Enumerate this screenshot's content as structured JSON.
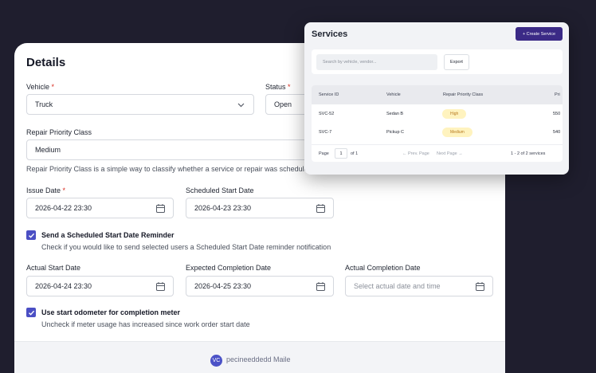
{
  "details": {
    "title": "Details",
    "vehicle": {
      "label": "Vehicle",
      "required_mark": "*",
      "value": "Truck"
    },
    "status": {
      "label": "Status",
      "required_mark": "*",
      "value": "Open"
    },
    "repair_priority": {
      "label": "Repair Priority Class",
      "value": "Medium",
      "helper": "Repair Priority Class is a simple way to classify whether a service or repair was schedule"
    },
    "issue_date": {
      "label": "Issue Date",
      "required_mark": "*",
      "value": "2026-04-22 23:30"
    },
    "scheduled_start": {
      "label": "Scheduled Start Date",
      "value": "2026-04-23 23:30"
    },
    "reminder": {
      "checked": true,
      "title": "Send a Scheduled Start Date Reminder",
      "helper": "Check if you would like to send selected users a Scheduled Start Date reminder notification"
    },
    "actual_start": {
      "label": "Actual Start Date",
      "value": "2026-04-24 23:30"
    },
    "expected_completion": {
      "label": "Expected Completion Date",
      "value": "2026-04-25 23:30"
    },
    "actual_completion": {
      "label": "Actual Completion Date",
      "placeholder": "Select actual date and time"
    },
    "odometer": {
      "checked": true,
      "title": "Use start odometer for completion meter",
      "helper": "Uncheck if meter usage has increased since work order start date"
    },
    "footer": {
      "logo_text": "VC",
      "brand": "pecineeddedd Maile"
    }
  },
  "services": {
    "title": "Services",
    "create_button": "+ Create Service",
    "search_placeholder": "Search by vehicle, vendor...",
    "export_button": "Export",
    "columns": [
      "Service ID",
      "Vehicle",
      "Repair Priority Class",
      "Pri"
    ],
    "rows": [
      {
        "id": "SVC-52",
        "vehicle": "Sedan B",
        "priority": "High",
        "pri": "550"
      },
      {
        "id": "SVC-7",
        "vehicle": "Pickup C",
        "priority": "Medium",
        "pri": "540"
      }
    ],
    "pager": {
      "page_label": "Page",
      "page": "1",
      "of": "of 1",
      "prev": "← Prev. Page",
      "next": "Next Page →",
      "summary": "1 - 2 of 2 services"
    }
  },
  "colors": {
    "accent": "#4b4fc4",
    "create_button": "#3b2a86",
    "pill_bg": "#fff3bf",
    "required": "#d92d20",
    "backdrop": "#1f1e2e"
  },
  "icons": [
    "chevron-down-icon",
    "calendar-icon",
    "check-icon",
    "brand-logo-icon"
  ]
}
